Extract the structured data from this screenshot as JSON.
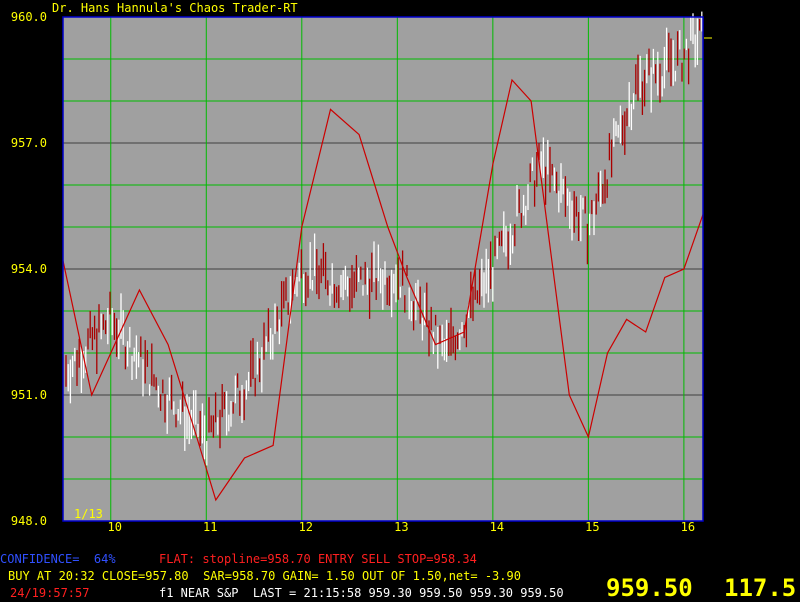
{
  "window": {
    "title": "Dr. Hans Hannula's Chaos Trader-RT"
  },
  "colors": {
    "background": "#000000",
    "plot_background": "#a0a0a0",
    "grid_green": "#00bb00",
    "grid_dark": "#404040",
    "frame_blue": "#0000cc",
    "text_yellow": "#ffff00",
    "text_red": "#ff2020",
    "text_blue": "#3050ff",
    "price_white": "#ffffff",
    "price_red": "#aa0000",
    "cycle_red": "#cc0000"
  },
  "status": {
    "confidence": "CONFIDENCE=  64%",
    "flat_line": "FLAT: stopline=958.70 ENTRY SELL STOP=958.34",
    "buy_line": "BUY AT 20:32 CLOSE=957.80  SAR=958.70 GAIN= 1.50 OUT OF 1.50,net= -3.90",
    "clock": "24/19:57:57",
    "near_line": "f1 NEAR S&P  LAST = 21:15:58 959.30 959.50 959.30 959.50",
    "big_price": "959.50",
    "big_value": "117.5"
  },
  "chart_data": {
    "type": "line",
    "title": "Dr. Hans Hannula's Chaos Trader-RT",
    "date_label": "1/13",
    "ylim": [
      948.0,
      960.0
    ],
    "y_ticks": [
      "960.0",
      "957.0",
      "954.0",
      "951.0",
      "948.0"
    ],
    "x_ticks": [
      "10",
      "11",
      "12",
      "13",
      "14",
      "15",
      "16"
    ],
    "x_tick_values": [
      10,
      11,
      12,
      13,
      14,
      15,
      16
    ],
    "xlim": [
      9.5,
      16.2
    ],
    "grid": true,
    "current_price_marker": 959.5,
    "series": [
      {
        "kind": "price_bars",
        "x": [
          9.5,
          10.0,
          10.5,
          11.0,
          11.5,
          12.0,
          12.5,
          13.0,
          13.5,
          14.0,
          14.5,
          15.0,
          15.5,
          16.0,
          16.15
        ],
        "values": [
          951.5,
          952.8,
          951.2,
          950.0,
          951.5,
          954.0,
          953.6,
          953.9,
          952.0,
          954.0,
          956.5,
          955.0,
          958.4,
          959.1,
          959.5
        ]
      },
      {
        "kind": "cycle_forecast",
        "x": [
          9.5,
          9.8,
          10.0,
          10.3,
          10.6,
          10.9,
          11.1,
          11.4,
          11.7,
          12.0,
          12.3,
          12.6,
          12.9,
          13.1,
          13.4,
          13.7,
          14.0,
          14.2,
          14.4,
          14.6,
          14.8,
          15.0,
          15.2,
          15.4,
          15.6,
          15.8,
          16.0,
          16.2
        ],
        "values": [
          954.2,
          951.0,
          952.0,
          953.5,
          952.2,
          950.0,
          948.5,
          949.5,
          949.8,
          955.0,
          957.8,
          957.2,
          955.0,
          953.8,
          952.2,
          952.5,
          956.5,
          958.5,
          958.0,
          954.5,
          951.0,
          950.0,
          952.0,
          952.8,
          952.5,
          953.8,
          954.0,
          955.3
        ]
      }
    ]
  }
}
